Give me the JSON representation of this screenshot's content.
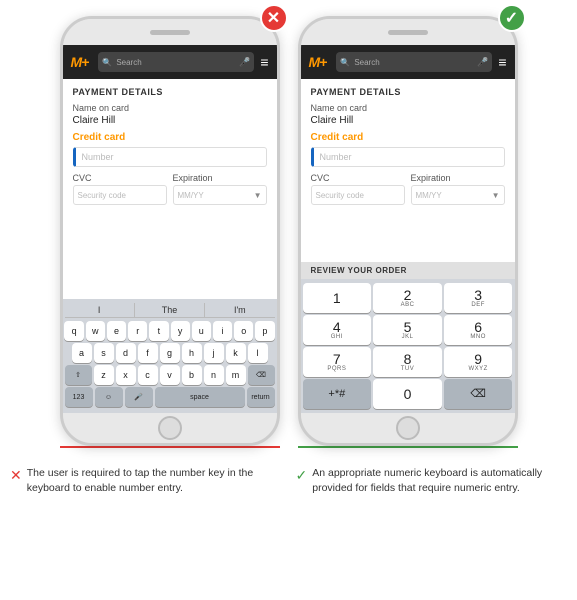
{
  "phones": [
    {
      "id": "bad",
      "indicator": "✕",
      "indicator_class": "bad",
      "navbar": {
        "logo": "M",
        "search_placeholder": "Search",
        "mic": "🎤",
        "menu": "≡"
      },
      "section_title": "PAYMENT DETAILS",
      "name_label": "Name on card",
      "name_value": "Claire Hill",
      "credit_card_label": "Credit card",
      "number_placeholder": "Number",
      "cvc_label": "CVC",
      "cvc_placeholder": "Security code",
      "expiry_label": "Expiration",
      "expiry_placeholder": "MM/YY",
      "keyboard_type": "qwerty",
      "suggestions": [
        "I",
        "The",
        "I'm"
      ],
      "rows": [
        [
          "q",
          "w",
          "e",
          "r",
          "t",
          "y",
          "u",
          "i",
          "o",
          "p"
        ],
        [
          "a",
          "s",
          "d",
          "f",
          "g",
          "h",
          "j",
          "k",
          "l"
        ],
        [
          "⇧",
          "z",
          "x",
          "c",
          "v",
          "b",
          "n",
          "m",
          "⌫"
        ],
        [
          "123",
          "☺",
          "🎤",
          "space",
          "return"
        ]
      ]
    },
    {
      "id": "good",
      "indicator": "✓",
      "indicator_class": "good",
      "navbar": {
        "logo": "M",
        "search_placeholder": "Search",
        "mic": "🎤",
        "menu": "≡"
      },
      "section_title": "PAYMENT DETAILS",
      "name_label": "Name on card",
      "name_value": "Claire Hill",
      "credit_card_label": "Credit card",
      "number_placeholder": "Number",
      "cvc_label": "CVC",
      "cvc_placeholder": "Security code",
      "expiry_label": "Expiration",
      "expiry_placeholder": "MM/YY",
      "review_bar": "REVIEW YOUR ORDER",
      "keyboard_type": "numeric",
      "num_keys": [
        {
          "main": "1",
          "sub": ""
        },
        {
          "main": "2",
          "sub": "ABC"
        },
        {
          "main": "3",
          "sub": "DEF"
        },
        {
          "main": "4",
          "sub": "GHI"
        },
        {
          "main": "5",
          "sub": "JKL"
        },
        {
          "main": "6",
          "sub": "MNO"
        },
        {
          "main": "7",
          "sub": "PQRS"
        },
        {
          "main": "8",
          "sub": "TUV"
        },
        {
          "main": "9",
          "sub": "WXYZ"
        },
        {
          "main": "+*#",
          "sub": "",
          "dark": true
        },
        {
          "main": "0",
          "sub": ""
        },
        {
          "main": "⌫",
          "sub": "",
          "dark": true
        }
      ]
    }
  ],
  "captions": [
    {
      "icon": "✕",
      "icon_class": "bad",
      "text": "The user is required to tap the number key in the keyboard to enable number entry."
    },
    {
      "icon": "✓",
      "icon_class": "good",
      "text": "An appropriate numeric keyboard is automatically provided for fields that require numeric entry."
    }
  ]
}
